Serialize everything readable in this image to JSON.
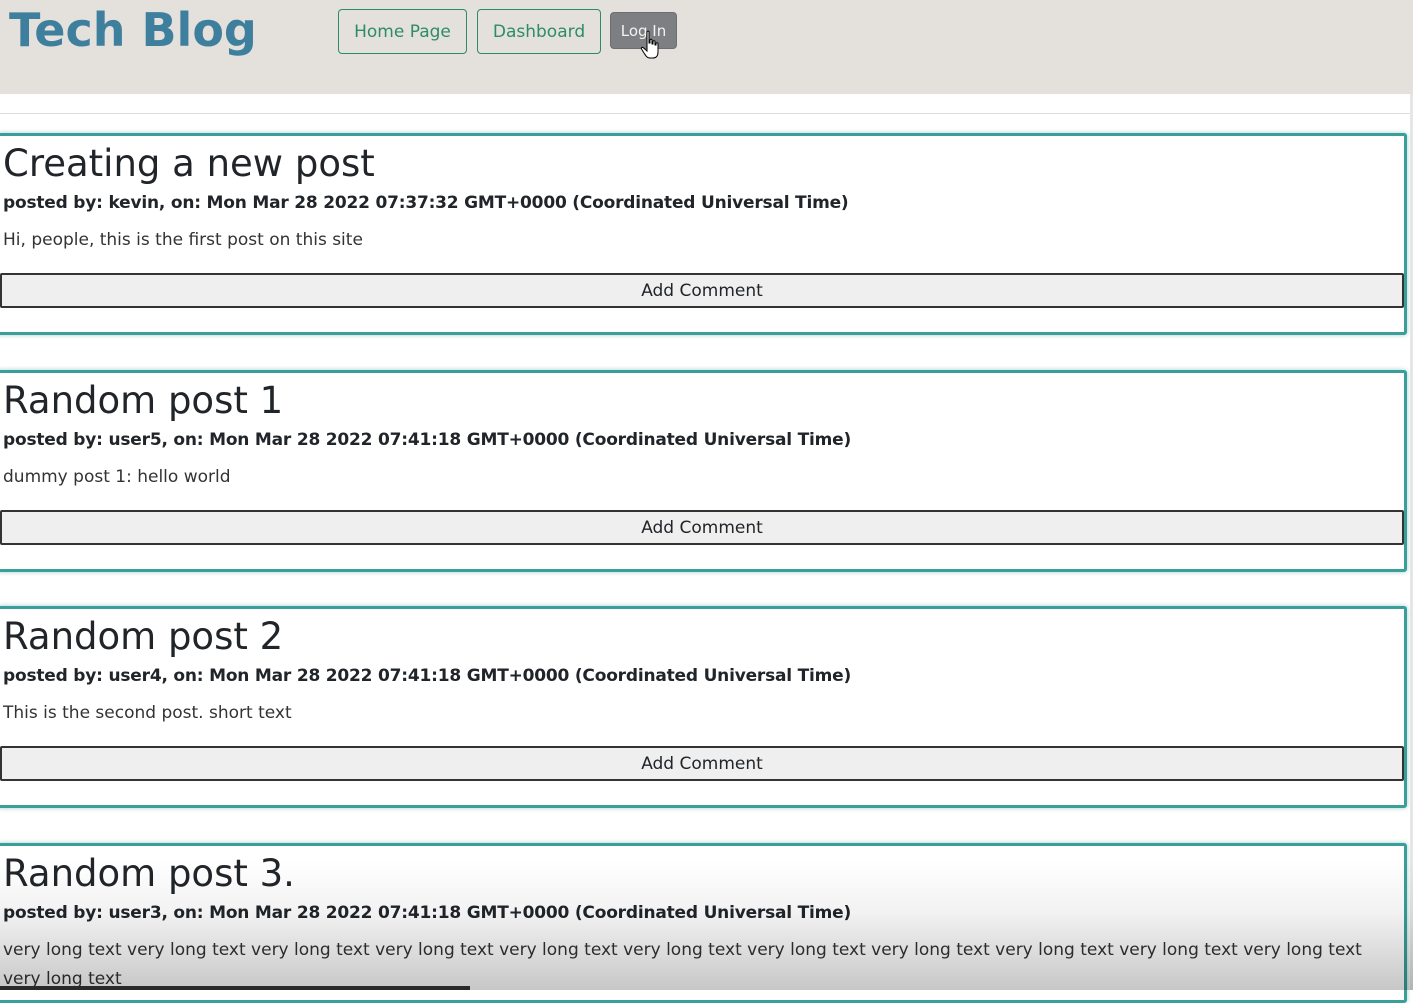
{
  "header": {
    "title": "Tech Blog",
    "nav": {
      "home_label": "Home Page",
      "dashboard_label": "Dashboard",
      "login_label": "Log In"
    }
  },
  "posts": [
    {
      "title": "Creating a new post",
      "meta": "posted by: kevin, on: Mon Mar 28 2022 07:37:32 GMT+0000 (Coordinated Universal Time)",
      "body": "Hi, people, this is the first post on this site",
      "comment_label": "Add Comment"
    },
    {
      "title": "Random post 1",
      "meta": "posted by: user5, on: Mon Mar 28 2022 07:41:18 GMT+0000 (Coordinated Universal Time)",
      "body": "dummy post 1: hello world",
      "comment_label": "Add Comment"
    },
    {
      "title": "Random post 2",
      "meta": "posted by: user4, on: Mon Mar 28 2022 07:41:18 GMT+0000 (Coordinated Universal Time)",
      "body": "This is the second post. short text",
      "comment_label": "Add Comment"
    },
    {
      "title": "Random post 3.",
      "meta": "posted by: user3, on: Mon Mar 28 2022 07:41:18 GMT+0000 (Coordinated Universal Time)",
      "body": "very long text very long text very long text very long text very long text very long text very long text very long text very long text very long text very long text very long text"
    }
  ],
  "colors": {
    "header_bg": "#e4e1dc",
    "title": "#3f7f9e",
    "nav_outline": "#2e8b6a",
    "login_bg": "#7d7f83",
    "post_border": "#3a9e9a"
  }
}
